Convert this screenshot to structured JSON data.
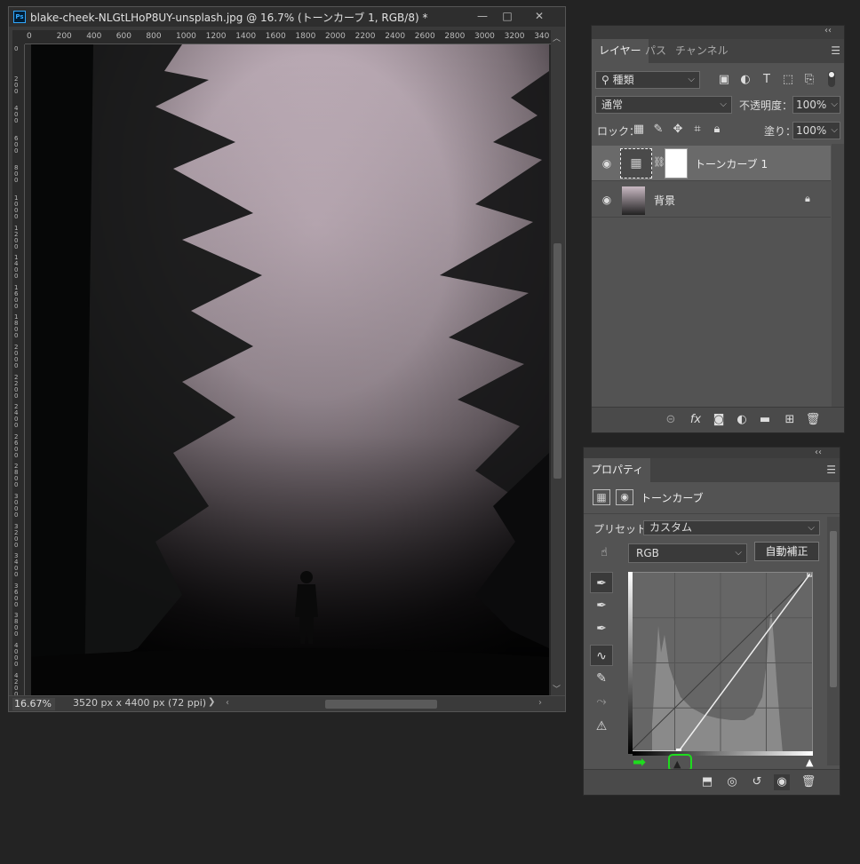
{
  "document": {
    "app_badge": "Ps",
    "title": "blake-cheek-NLGtLHoP8UY-unsplash.jpg @ 16.7% (トーンカーブ 1, RGB/8) *",
    "window_controls": [
      "—",
      "□",
      "✕"
    ],
    "ruler_top_ticks": [
      "0",
      "200",
      "400",
      "600",
      "800",
      "1000",
      "1200",
      "1400",
      "1600",
      "1800",
      "2000",
      "2200",
      "2400",
      "2600",
      "2800",
      "3000",
      "3200",
      "340"
    ],
    "ruler_left_ticks": [
      "0",
      "2 0 0",
      "4 0 0",
      "6 0 0",
      "8 0 0",
      "1 0 0 0",
      "1 2 0 0",
      "1 4 0 0",
      "1 6 0 0",
      "1 8 0 0",
      "2 0 0 0",
      "2 2 0 0",
      "2 4 0 0",
      "2 6 0 0",
      "2 8 0 0",
      "3 0 0 0",
      "3 2 0 0",
      "3 4 0 0",
      "3 6 0 0",
      "3 8 0 0",
      "4 0 0 0",
      "4 2 0 0"
    ],
    "zoom": "16.67%",
    "doc_size": "3520 px x 4400 px (72 ppi)",
    "status_arrow": "❯"
  },
  "layers_panel": {
    "collapse": "‹‹",
    "tabs": [
      "レイヤー",
      "パス",
      "チャンネル"
    ],
    "filter_label": "種類",
    "blend_mode": "通常",
    "opacity_label": "不透明度：",
    "opacity_value": "100%",
    "lock_label": "ロック：",
    "fill_label": "塗り：",
    "fill_value": "100%",
    "layers": [
      {
        "name": "トーンカーブ 1",
        "visible": true,
        "selected": true,
        "type": "adjustment"
      },
      {
        "name": "背景",
        "visible": true,
        "selected": false,
        "type": "image",
        "locked": true
      }
    ],
    "footer_icons": [
      "link-icon",
      "fx-icon",
      "mask-icon",
      "adjustment-icon",
      "folder-icon",
      "new-layer-icon",
      "trash-icon"
    ]
  },
  "properties_panel": {
    "collapse": "‹‹",
    "tab": "プロパティ",
    "adjustment_name": "トーンカーブ",
    "preset_label": "プリセット：",
    "preset_value": "カスタム",
    "channel_value": "RGB",
    "auto_button": "自動補正",
    "curve": {
      "black_input": 56,
      "white_input": 255,
      "histogram_peaks": "left and right"
    }
  },
  "colors": {
    "panel_bg": "#535353",
    "app_bg": "#232323",
    "highlight": "#1edc1e",
    "ps_blue": "#31a8ff"
  }
}
